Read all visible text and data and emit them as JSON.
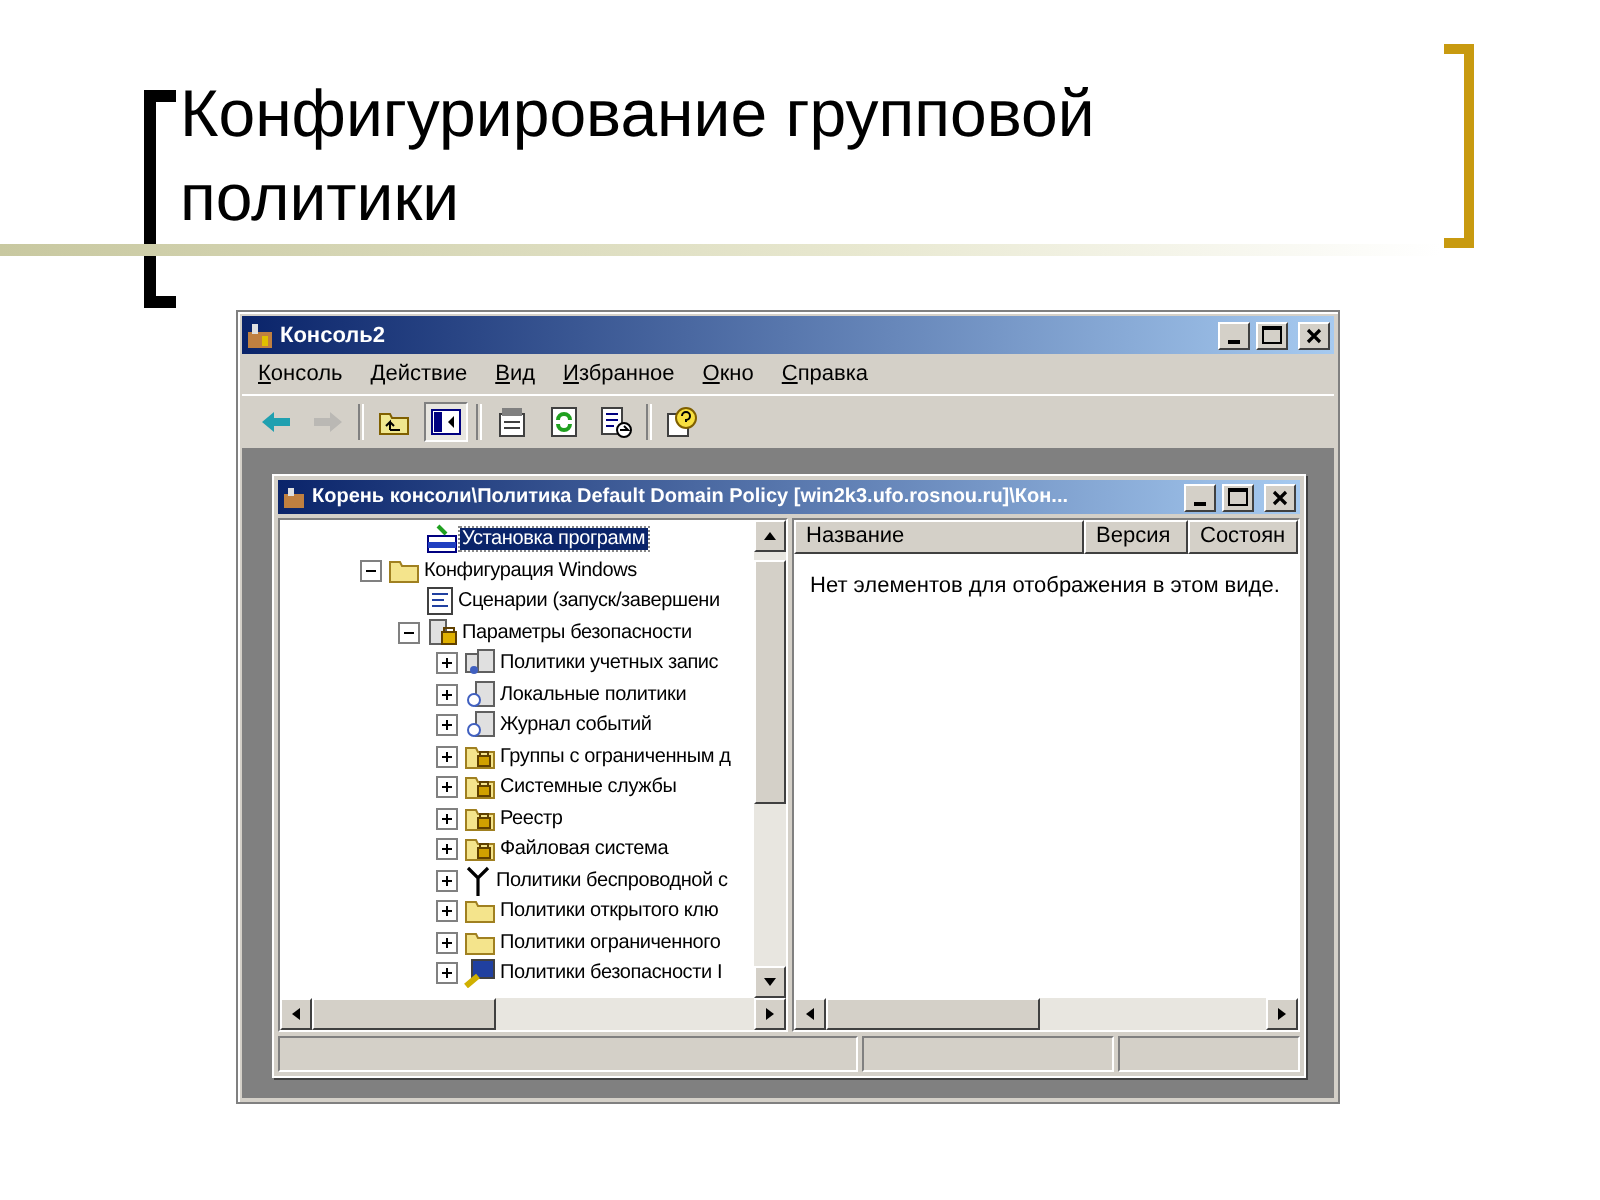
{
  "slide": {
    "title": "Конфигурирование групповой политики"
  },
  "window": {
    "title": "Консоль2",
    "menu": [
      "Консоль",
      "Действие",
      "Вид",
      "Избранное",
      "Окно",
      "Справка"
    ],
    "toolbar": [
      {
        "kind": "back",
        "disabled": false,
        "pressed": false
      },
      {
        "kind": "forward",
        "disabled": true,
        "pressed": false
      },
      {
        "kind": "separator"
      },
      {
        "kind": "up",
        "disabled": false,
        "pressed": false
      },
      {
        "kind": "tree",
        "disabled": false,
        "pressed": true
      },
      {
        "kind": "separator"
      },
      {
        "kind": "properties",
        "disabled": false,
        "pressed": false
      },
      {
        "kind": "refresh",
        "disabled": false,
        "pressed": false
      },
      {
        "kind": "export",
        "disabled": false,
        "pressed": false
      },
      {
        "kind": "separator"
      },
      {
        "kind": "help",
        "disabled": false,
        "pressed": false
      }
    ]
  },
  "child_window": {
    "title": "Корень консоли\\Политика Default Domain Policy [win2k3.ufo.rosnou.ru]\\Кон...",
    "tree": {
      "scrolled_branch": [
        {
          "label": "Установка программ",
          "kind": "install",
          "selected": true
        }
      ],
      "items": [
        {
          "label": "Конфигурация Windows",
          "kind": "folder",
          "selected": false,
          "expanded": true,
          "children": [
            {
              "label": "Сценарии (запуск/завершени",
              "kind": "script",
              "selected": false
            },
            {
              "label": "Параметры безопасности",
              "kind": "security",
              "selected": false,
              "expanded": true,
              "children": [
                {
                  "label": "Политики учетных запис",
                  "kind": "accounts",
                  "selected": false,
                  "expanded": false
                },
                {
                  "label": "Локальные политики",
                  "kind": "computer",
                  "selected": false,
                  "expanded": false
                },
                {
                  "label": "Журнал событий",
                  "kind": "computer",
                  "selected": false,
                  "expanded": false
                },
                {
                  "label": "Группы с ограниченным д",
                  "kind": "lockfolder",
                  "selected": false,
                  "expanded": false
                },
                {
                  "label": "Системные службы",
                  "kind": "lockfolder",
                  "selected": false,
                  "expanded": false
                },
                {
                  "label": "Реестр",
                  "kind": "lockfolder",
                  "selected": false,
                  "expanded": false
                },
                {
                  "label": "Файловая система",
                  "kind": "lockfolder",
                  "selected": false,
                  "expanded": false
                },
                {
                  "label": "Политики беспроводной с",
                  "kind": "antenna",
                  "selected": false,
                  "expanded": false
                },
                {
                  "label": "Политики открытого клю",
                  "kind": "folder",
                  "selected": false,
                  "expanded": false
                },
                {
                  "label": "Политики ограниченного",
                  "kind": "folder",
                  "selected": false,
                  "expanded": false
                },
                {
                  "label": "Политики безопасности I",
                  "kind": "ipsec",
                  "selected": false,
                  "expanded": false
                }
              ]
            }
          ]
        }
      ]
    },
    "list": {
      "columns": [
        "Название",
        "Версия",
        "Состоян"
      ],
      "empty_message": "Нет элементов для отображения в этом виде."
    }
  }
}
